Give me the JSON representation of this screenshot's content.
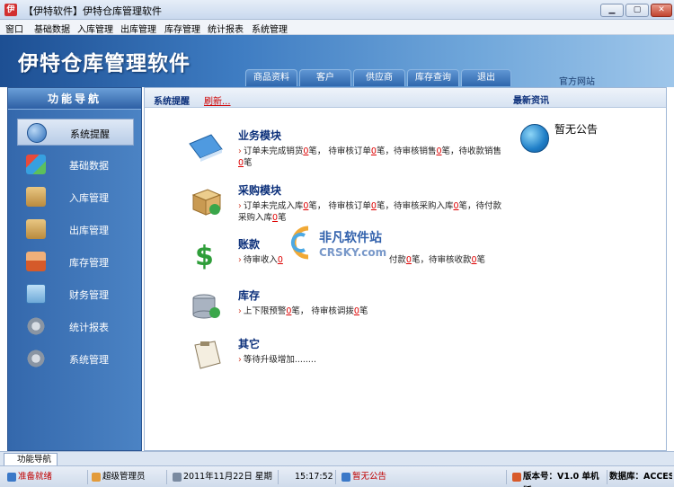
{
  "window": {
    "title": "【伊特软件】伊特仓库管理软件",
    "buttons": [
      "minimize",
      "restore",
      "close"
    ]
  },
  "menu": [
    "窗口",
    "基础数据",
    "入库管理",
    "出库管理",
    "库存管理",
    "统计报表",
    "系统管理"
  ],
  "banner": {
    "title": "伊特仓库管理软件",
    "tabs": [
      "商品资料",
      "客户",
      "供应商",
      "库存查询",
      "退出"
    ],
    "official_site": "官方网站"
  },
  "sidebar": {
    "header": "功能导航",
    "items": [
      {
        "label": "系统提醒",
        "icon": "info-icon",
        "active": true
      },
      {
        "label": "基础数据",
        "icon": "cubes-icon"
      },
      {
        "label": "入库管理",
        "icon": "box-in-icon"
      },
      {
        "label": "出库管理",
        "icon": "box-out-icon"
      },
      {
        "label": "库存管理",
        "icon": "house-icon"
      },
      {
        "label": "财务管理",
        "icon": "chart-icon"
      },
      {
        "label": "统计报表",
        "icon": "gears-icon"
      },
      {
        "label": "系统管理",
        "icon": "gears-icon"
      }
    ]
  },
  "main": {
    "header_left": "系统提醒",
    "refresh": "刷新...",
    "header_right": "最新资讯",
    "notice": "暂无公告",
    "modules": [
      {
        "title": "业务模块",
        "line1": [
          "订单未完成销货",
          "0",
          "笔，  待审核订单",
          "0",
          "笔，待审核销售",
          "0",
          "笔，待收款销售"
        ],
        "line2": [
          "",
          "0",
          "笔"
        ]
      },
      {
        "title": "采购模块",
        "line1": [
          "订单未完成入库",
          "0",
          "笔，  待审核订单",
          "0",
          "笔，待审核采购入库",
          "0",
          "笔，待付款"
        ],
        "line2": [
          "采购入库",
          "0",
          "笔"
        ]
      },
      {
        "title": "账款",
        "line1": [
          "待审收入",
          "0",
          "笔",
          "",
          "付款",
          "0",
          "笔，待审核收款",
          "0",
          "笔"
        ]
      },
      {
        "title": "库存",
        "line1": [
          "上下限预警",
          "0",
          "笔，  待审核调拨",
          "0",
          "笔"
        ]
      },
      {
        "title": "其它",
        "line1": [
          "等待升级增加........"
        ]
      }
    ],
    "watermark": {
      "cn": "非凡软件站",
      "en": "CRSKY.com"
    }
  },
  "taskbar": {
    "tab": "功能导航"
  },
  "status": {
    "ready": "准备就绪",
    "user": "超级管理员",
    "date": "2011年11月22日 星期二",
    "time": "15:17:52",
    "notice": "暂无公告",
    "version": "版本号：V1.0 单机版",
    "database": "数据库：ACCESS"
  },
  "colors": {
    "accent": "#2f67ad",
    "highlight": "#d00000",
    "title_blue": "#0b2f7a"
  }
}
